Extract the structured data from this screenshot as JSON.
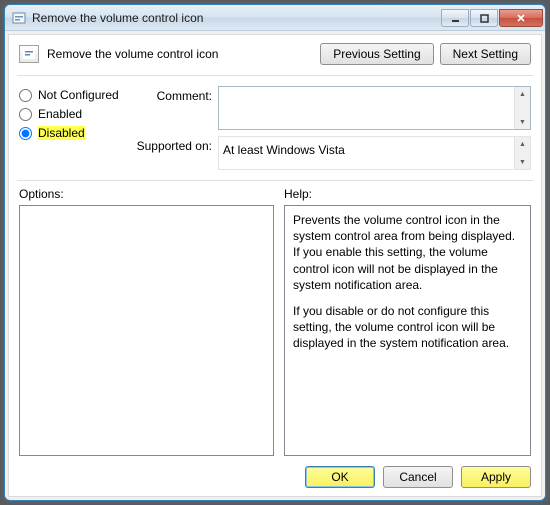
{
  "window": {
    "title": "Remove the volume control icon"
  },
  "header": {
    "policy_name": "Remove the volume control icon",
    "prev_label": "Previous Setting",
    "next_label": "Next Setting"
  },
  "radios": {
    "not_configured": "Not Configured",
    "enabled": "Enabled",
    "disabled": "Disabled",
    "selected": "disabled"
  },
  "fields": {
    "comment_label": "Comment:",
    "comment_value": "",
    "supported_label": "Supported on:",
    "supported_value": "At least Windows Vista"
  },
  "panels": {
    "options_label": "Options:",
    "help_label": "Help:",
    "help_p1": "Prevents the volume control icon in the system control area from being displayed. If you enable this setting, the volume control icon will not be displayed in the system notification area.",
    "help_p2": "If you disable or do not configure this setting, the volume control icon will be displayed in the system notification area."
  },
  "footer": {
    "ok": "OK",
    "cancel": "Cancel",
    "apply": "Apply"
  }
}
